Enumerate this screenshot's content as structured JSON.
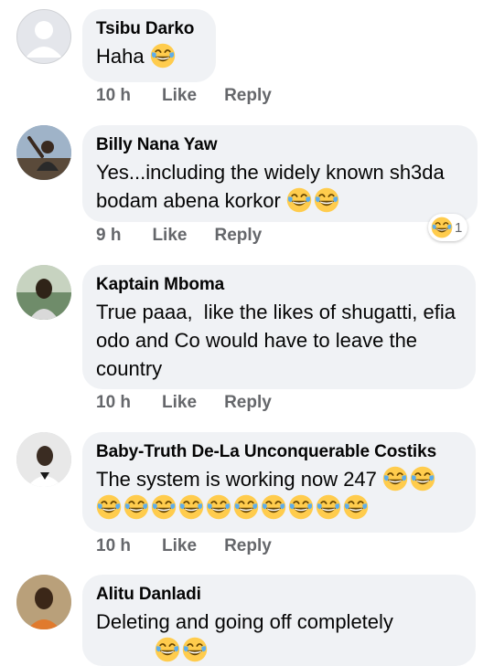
{
  "comments": [
    {
      "author": "Tsibu Darko",
      "text": "Haha",
      "time": "10 h",
      "like": "Like",
      "reply": "Reply"
    },
    {
      "author": "Billy Nana Yaw",
      "text": "Yes...including the widely known sh3da bodam abena korkor",
      "time": "9 h",
      "like": "Like",
      "reply": "Reply",
      "reaction_count": "1"
    },
    {
      "author": "Kaptain Mboma",
      "text": "True paaa,  like the likes of shugatti, efia odo and Co would have to leave the country",
      "time": "10 h",
      "like": "Like",
      "reply": "Reply"
    },
    {
      "author": "Baby-Truth De-La Unconquerable Costiks",
      "text": "The system is working now 247",
      "time": "10 h",
      "like": "Like",
      "reply": "Reply"
    },
    {
      "author": "Alitu Danladi",
      "text": "Deleting and going off completely"
    }
  ],
  "icons": {
    "emoji": "laughing-tears-emoji",
    "reaction": "haha-reaction-icon"
  },
  "colors": {
    "bubble": "#f0f2f5",
    "meta": "#65676b",
    "text": "#050505",
    "emoji_face": "#ffcc4d"
  }
}
